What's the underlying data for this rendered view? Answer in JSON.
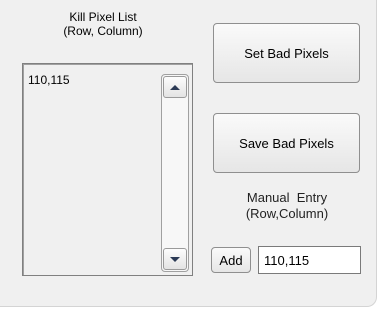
{
  "kill_list": {
    "title_line1": "Kill Pixel List",
    "title_line2": "(Row, Column)",
    "items": [
      "110,115"
    ],
    "scroll_up_icon": "triangle-up",
    "scroll_down_icon": "triangle-down"
  },
  "buttons": {
    "set_bad_pixels": "Set Bad Pixels",
    "save_bad_pixels": "Save Bad Pixels",
    "add": "Add"
  },
  "manual_entry": {
    "label_line1": "Manual  Entry",
    "label_line2": "(Row,Column)",
    "value": "110,115"
  }
}
